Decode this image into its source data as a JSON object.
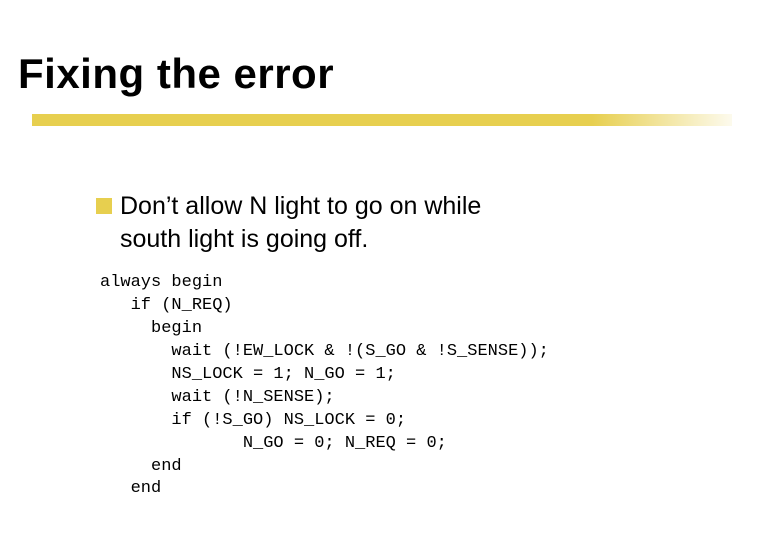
{
  "title": "Fixing the error",
  "bullet": {
    "line1": "Don’t allow N light to go on while",
    "line2": "south light is going off."
  },
  "code": {
    "l1": "always begin",
    "l2": "   if (N_REQ)",
    "l3": "     begin",
    "l4": "       wait (!EW_LOCK & !(S_GO & !S_SENSE));",
    "l5": "       NS_LOCK = 1; N_GO = 1;",
    "l6": "       wait (!N_SENSE);",
    "l7": "       if (!S_GO) NS_LOCK = 0;",
    "l8": "              N_GO = 0; N_REQ = 0;",
    "l9": "     end",
    "l10": "   end"
  }
}
